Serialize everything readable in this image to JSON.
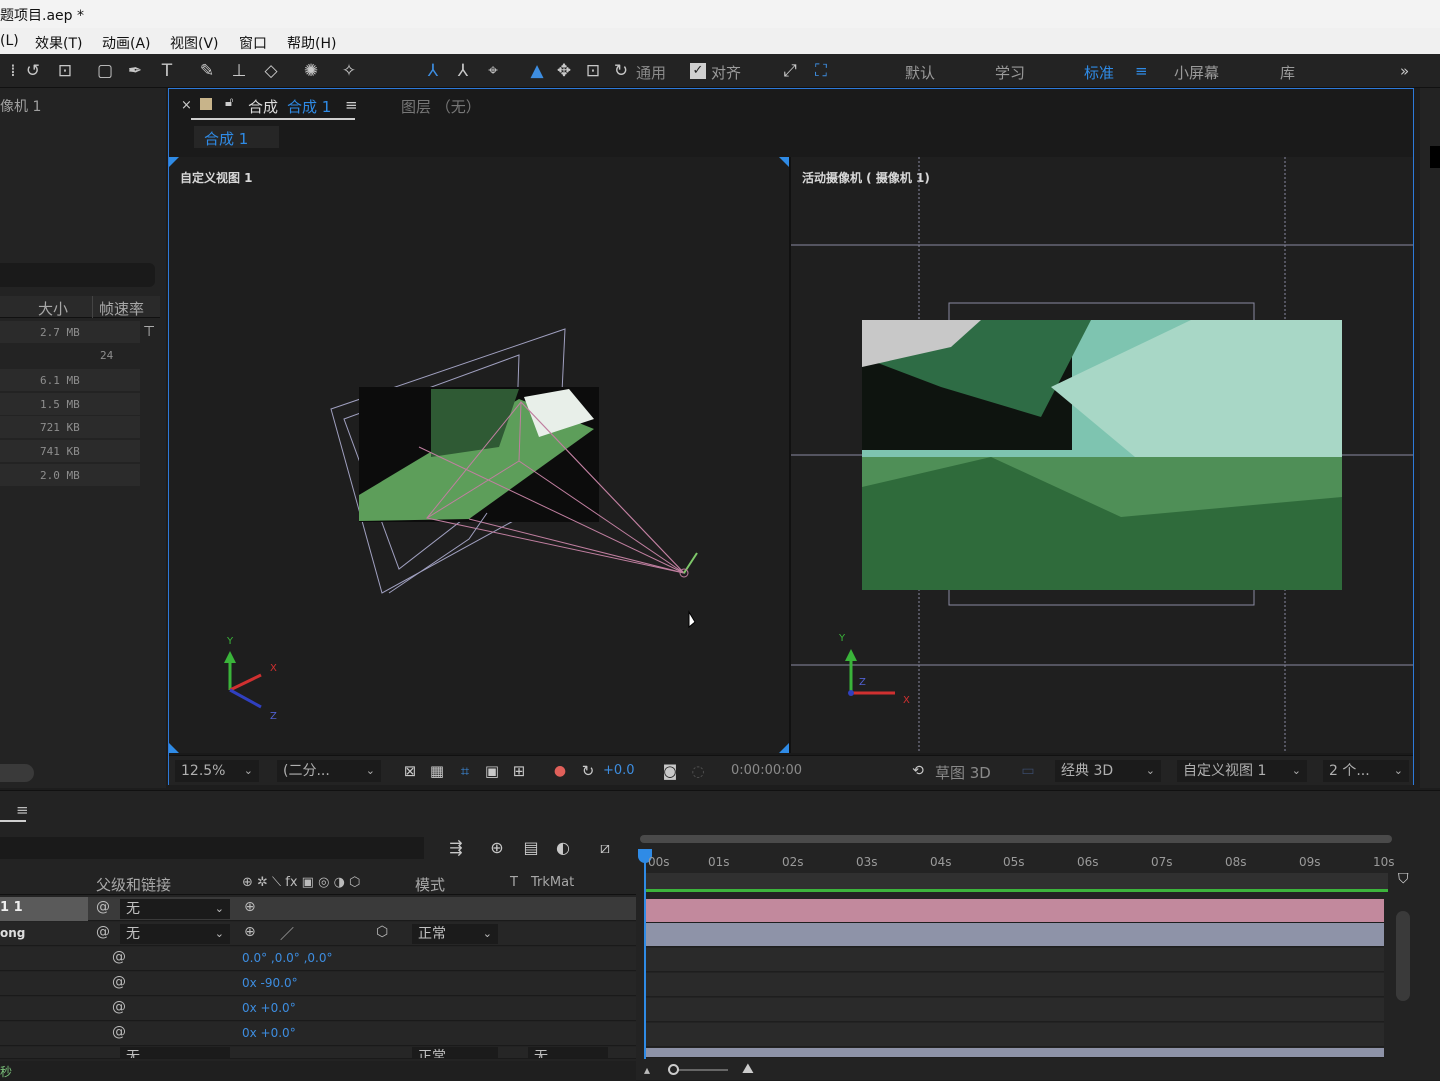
{
  "title": "题项目.aep *",
  "menu": [
    "(L)",
    "效果(T)",
    "动画(A)",
    "视图(V)",
    "窗口",
    "帮助(H)"
  ],
  "toolbar": {
    "general_label": "通用",
    "align_label": "对齐",
    "workspaces": [
      "默认",
      "学习",
      "标准",
      "小屏幕",
      "库"
    ],
    "active_workspace": "标准"
  },
  "project": {
    "item_label": "像机 1",
    "col_size": "大小",
    "col_fps": "帧速率",
    "rows": [
      {
        "size": "2.7 MB",
        "fps": ""
      },
      {
        "size": "",
        "fps": "24"
      },
      {
        "size": "6.1 MB",
        "fps": ""
      },
      {
        "size": "1.5 MB",
        "fps": ""
      },
      {
        "size": "721 KB",
        "fps": ""
      },
      {
        "size": "741 KB",
        "fps": ""
      },
      {
        "size": "2.0 MB",
        "fps": ""
      }
    ]
  },
  "comp": {
    "close": "×",
    "tab_prefix": "合成",
    "tab_name": "合成 1",
    "layer_tab": "图层 （无）",
    "breadcrumb": "合成 1",
    "left_view_label": "自定义视图 1",
    "right_view_label": "活动摄像机 ( 摄像机 1)",
    "axis_x": "X",
    "axis_y": "Y",
    "axis_z": "Z",
    "zoom": "12.5%",
    "resolution": "(二分...",
    "exposure": "+0.0",
    "timecode": "0:00:00:00",
    "draft3d": "草图 3D",
    "renderer": "经典 3D",
    "view_select": "自定义视图 1",
    "view_layout": "2 个..."
  },
  "timeline": {
    "col_parent": "父级和链接",
    "col_mode": "模式",
    "col_t": "T",
    "col_trkmat": "TrkMat",
    "ticks": [
      "00s",
      "01s",
      "02s",
      "03s",
      "04s",
      "05s",
      "06s",
      "07s",
      "08s",
      "09s",
      "10s"
    ],
    "layers": [
      {
        "name": "1 1",
        "parent": "无"
      },
      {
        "name": "ong",
        "parent": "无",
        "mode": "正常"
      }
    ],
    "props": [
      "0.0° ,0.0° ,0.0°",
      "0x -90.0°",
      "0x +0.0°",
      "0x +0.0°"
    ],
    "last_row": {
      "parent": "无",
      "mode": "正常",
      "trk": "无"
    },
    "status": "秒"
  },
  "colors": {
    "accent": "#2f8be6",
    "selection": "#2d79d8",
    "layer_bar": "#c2899d",
    "layer_bar2": "#8e93a8"
  }
}
